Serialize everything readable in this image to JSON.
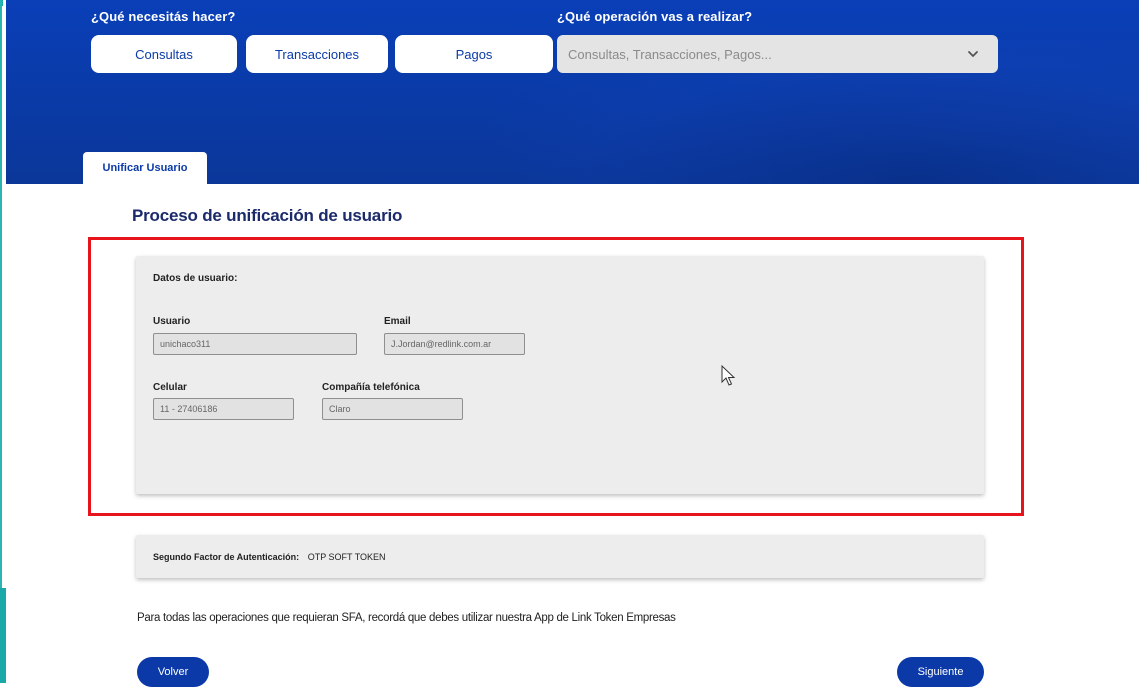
{
  "header": {
    "question_1": "¿Qué necesitás hacer?",
    "question_2": "¿Qué operación vas a realizar?",
    "buttons": {
      "consultas": "Consultas",
      "transacciones": "Transacciones",
      "pagos": "Pagos"
    },
    "operation_select": {
      "placeholder": "Consultas, Transacciones, Pagos..."
    }
  },
  "tab": {
    "label": "Unificar Usuario"
  },
  "page_title": "Proceso de unificación de usuario",
  "user_data": {
    "section_label": "Datos de usuario:",
    "usuario": {
      "label": "Usuario",
      "value": "unichaco311"
    },
    "email": {
      "label": "Email",
      "value": "J.Jordan@redlink.com.ar"
    },
    "celular": {
      "label": "Celular",
      "value": "11 - 27406186"
    },
    "compania": {
      "label": "Compañía telefónica",
      "value": "Claro"
    }
  },
  "sfa": {
    "label": "Segundo Factor de Autenticación:",
    "value": "OTP SOFT TOKEN"
  },
  "note": "Para todas las operaciones que requieran SFA, recordá que debes utilizar nuestra App de Link Token Empresas",
  "actions": {
    "back": "Volver",
    "next": "Siguiente"
  },
  "colors": {
    "brand_blue": "#0b3aa8",
    "highlight_red": "#e8141b",
    "accent_teal": "#1aa8a8"
  }
}
